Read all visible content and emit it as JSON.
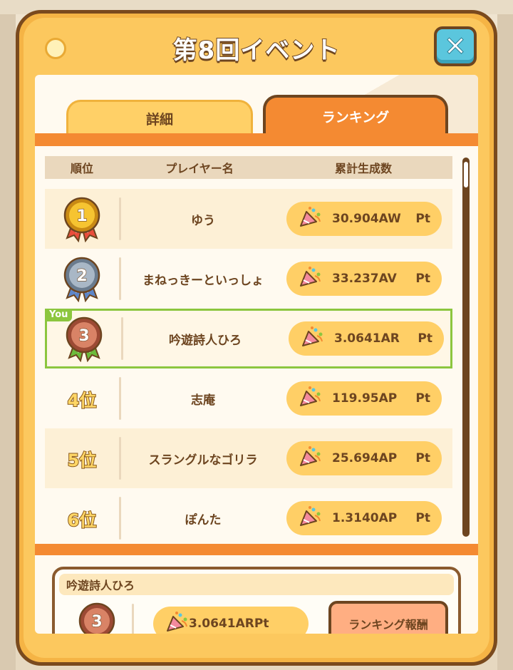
{
  "dialog": {
    "title": "第8回イベント"
  },
  "tabs": [
    {
      "label": "詳細",
      "active": false
    },
    {
      "label": "ランキング",
      "active": true
    }
  ],
  "table": {
    "headers": [
      "順位",
      "プレイヤー名",
      "累計生成数"
    ],
    "rows": [
      {
        "rank": "1",
        "rank_label": "",
        "medal": "gold",
        "name": "ゆう",
        "score": "30.904AW",
        "unit": "Pt",
        "me": false
      },
      {
        "rank": "2",
        "rank_label": "",
        "medal": "silver",
        "name": "まねっきーといっしょ",
        "score": "33.237AV",
        "unit": "Pt",
        "me": false
      },
      {
        "rank": "3",
        "rank_label": "",
        "medal": "bronze",
        "name": "吟遊詩人ひろ",
        "score": "3.0641AR",
        "unit": "Pt",
        "me": true
      },
      {
        "rank": "4",
        "rank_label": "4位",
        "medal": "",
        "name": "志庵",
        "score": "119.95AP",
        "unit": "Pt",
        "me": false
      },
      {
        "rank": "5",
        "rank_label": "5位",
        "medal": "",
        "name": "スラングルなゴリラ",
        "score": "25.694AP",
        "unit": "Pt",
        "me": false
      },
      {
        "rank": "6",
        "rank_label": "6位",
        "medal": "",
        "name": "ぽんた",
        "score": "1.3140AP",
        "unit": "Pt",
        "me": false
      }
    ]
  },
  "you_badge": "You",
  "my_rank": {
    "name": "吟遊詩人ひろ",
    "rank": "3",
    "score": "3.0641AR",
    "unit": "Pt",
    "reward_button": "ランキング報酬"
  },
  "colors": {
    "frame": "#f5b445",
    "frame_border": "#7a4a1e",
    "accent_orange": "#f48a32",
    "pill": "#ffcf66",
    "me_highlight": "#8cc63f",
    "close_button": "#5bc6dd"
  }
}
